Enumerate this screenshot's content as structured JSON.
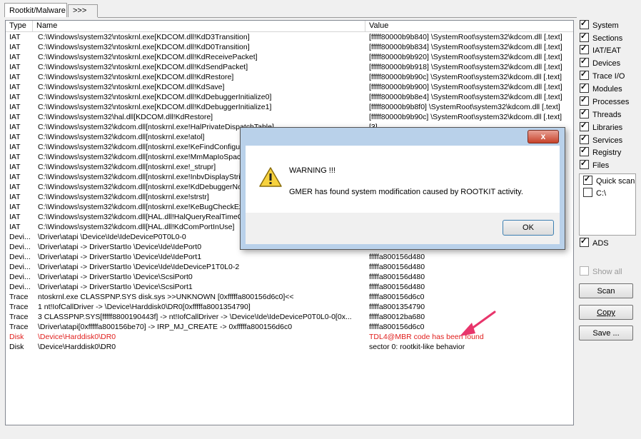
{
  "tabs": {
    "active": "Rootkit/Malware",
    "next": ">>>"
  },
  "columns": [
    "Type",
    "Name",
    "Value"
  ],
  "rows": [
    {
      "type": "IAT",
      "name": "C:\\Windows\\system32\\ntoskrnl.exe[KDCOM.dll!KdD3Transition]",
      "value": "[fffff80000b9b840] \\SystemRoot\\system32\\kdcom.dll [.text]"
    },
    {
      "type": "IAT",
      "name": "C:\\Windows\\system32\\ntoskrnl.exe[KDCOM.dll!KdD0Transition]",
      "value": "[fffff80000b9b834] \\SystemRoot\\system32\\kdcom.dll [.text]"
    },
    {
      "type": "IAT",
      "name": "C:\\Windows\\system32\\ntoskrnl.exe[KDCOM.dll!KdReceivePacket]",
      "value": "[fffff80000b9b920] \\SystemRoot\\system32\\kdcom.dll [.text]"
    },
    {
      "type": "IAT",
      "name": "C:\\Windows\\system32\\ntoskrnl.exe[KDCOM.dll!KdSendPacket]",
      "value": "[fffff80000b9b918] \\SystemRoot\\system32\\kdcom.dll [.text]"
    },
    {
      "type": "IAT",
      "name": "C:\\Windows\\system32\\ntoskrnl.exe[KDCOM.dll!KdRestore]",
      "value": "[fffff80000b9b90c] \\SystemRoot\\system32\\kdcom.dll [.text]"
    },
    {
      "type": "IAT",
      "name": "C:\\Windows\\system32\\ntoskrnl.exe[KDCOM.dll!KdSave]",
      "value": "[fffff80000b9b900] \\SystemRoot\\system32\\kdcom.dll [.text]"
    },
    {
      "type": "IAT",
      "name": "C:\\Windows\\system32\\ntoskrnl.exe[KDCOM.dll!KdDebuggerInitialize0]",
      "value": "[fffff80000b9b8e4] \\SystemRoot\\system32\\kdcom.dll [.text]"
    },
    {
      "type": "IAT",
      "name": "C:\\Windows\\system32\\ntoskrnl.exe[KDCOM.dll!KdDebuggerInitialize1]",
      "value": "[fffff80000b9b8f0] \\SystemRoot\\system32\\kdcom.dll [.text]"
    },
    {
      "type": "IAT",
      "name": "C:\\Windows\\system32\\hal.dll[KDCOM.dll!KdRestore]",
      "value": "[fffff80000b9b90c] \\SystemRoot\\system32\\kdcom.dll [.text]"
    },
    {
      "type": "IAT",
      "name": "C:\\Windows\\system32\\kdcom.dll[ntoskrnl.exe!HalPrivateDispatchTable]",
      "value": "[3]"
    },
    {
      "type": "IAT",
      "name": "C:\\Windows\\system32\\kdcom.dll[ntoskrnl.exe!atol]",
      "value": ""
    },
    {
      "type": "IAT",
      "name": "C:\\Windows\\system32\\kdcom.dll[ntoskrnl.exe!KeFindConfigurationEntry]",
      "value": ""
    },
    {
      "type": "IAT",
      "name": "C:\\Windows\\system32\\kdcom.dll[ntoskrnl.exe!MmMapIoSpace]",
      "value": ""
    },
    {
      "type": "IAT",
      "name": "C:\\Windows\\system32\\kdcom.dll[ntoskrnl.exe!_strupr]",
      "value": ""
    },
    {
      "type": "IAT",
      "name": "C:\\Windows\\system32\\kdcom.dll[ntoskrnl.exe!InbvDisplayString]",
      "value": ""
    },
    {
      "type": "IAT",
      "name": "C:\\Windows\\system32\\kdcom.dll[ntoskrnl.exe!KdDebuggerNotPresent]",
      "value": ""
    },
    {
      "type": "IAT",
      "name": "C:\\Windows\\system32\\kdcom.dll[ntoskrnl.exe!strstr]",
      "value": ""
    },
    {
      "type": "IAT",
      "name": "C:\\Windows\\system32\\kdcom.dll[ntoskrnl.exe!KeBugCheckEx]",
      "value": ""
    },
    {
      "type": "IAT",
      "name": "C:\\Windows\\system32\\kdcom.dll[HAL.dll!HalQueryRealTimeClock]",
      "value": ""
    },
    {
      "type": "IAT",
      "name": "C:\\Windows\\system32\\kdcom.dll[HAL.dll!KdComPortInUse]",
      "value": ""
    },
    {
      "type": "Devi...",
      "name": "\\Driver\\atapi \\Device\\Ide\\IdeDeviceP0T0L0-0",
      "value": ""
    },
    {
      "type": "Devi...",
      "name": "\\Driver\\atapi -> DriverStartIo \\Device\\Ide\\IdePort0",
      "value": ""
    },
    {
      "type": "Devi...",
      "name": "\\Driver\\atapi -> DriverStartIo \\Device\\Ide\\IdePort1",
      "value": "fffffa800156d480"
    },
    {
      "type": "Devi...",
      "name": "\\Driver\\atapi -> DriverStartIo \\Device\\Ide\\IdeDeviceP1T0L0-2",
      "value": "fffffa800156d480"
    },
    {
      "type": "Devi...",
      "name": "\\Driver\\atapi -> DriverStartIo \\Device\\ScsiPort0",
      "value": "fffffa800156d480"
    },
    {
      "type": "Devi...",
      "name": "\\Driver\\atapi -> DriverStartIo \\Device\\ScsiPort1",
      "value": "fffffa800156d480"
    },
    {
      "type": "Trace",
      "name": "ntoskrnl.exe CLASSPNP.SYS disk.sys >>UNKNOWN [0xfffffa800156d6c0]<<",
      "value": "fffffa800156d6c0"
    },
    {
      "type": "Trace",
      "name": "1 nt!IofCallDriver -> \\Device\\Harddisk0\\DR0[0xfffffa8001354790]",
      "value": "fffffa8001354790"
    },
    {
      "type": "Trace",
      "name": "3 CLASSPNP.SYS[fffff8800190443f] -> nt!IofCallDriver -> \\Device\\Ide\\IdeDeviceP0T0L0-0[0x...",
      "value": "fffffa80012ba680"
    },
    {
      "type": "Trace",
      "name": "\\Driver\\atapi[0xfffffa800156be70] -> IRP_MJ_CREATE -> 0xfffffa800156d6c0",
      "value": "fffffa800156d6c0"
    },
    {
      "type": "Disk",
      "name": "\\Device\\Harddisk0\\DR0",
      "value": "TDL4@MBR code has been found",
      "alert": true
    },
    {
      "type": "Disk",
      "name": "\\Device\\Harddisk0\\DR0",
      "value": "sector 0: rootkit-like behavior"
    }
  ],
  "options": {
    "system": "System",
    "sections": "Sections",
    "iat_eat": "IAT/EAT",
    "devices": "Devices",
    "trace_io": "Trace I/O",
    "modules": "Modules",
    "processes": "Processes",
    "threads": "Threads",
    "libraries": "Libraries",
    "services": "Services",
    "registry": "Registry",
    "files": "Files",
    "quick_scan": "Quick scan",
    "drive_c": "C:\\",
    "ads": "ADS",
    "show_all": "Show all"
  },
  "buttons": {
    "scan": "Scan",
    "copy": "Copy",
    "save": "Save ..."
  },
  "dialog": {
    "close": "x",
    "title": "WARNING !!!",
    "message": "GMER has found system modification caused by ROOTKIT activity.",
    "ok": "OK"
  },
  "colors": {
    "alert": "#e0201e",
    "arrow": "#e8356b"
  }
}
